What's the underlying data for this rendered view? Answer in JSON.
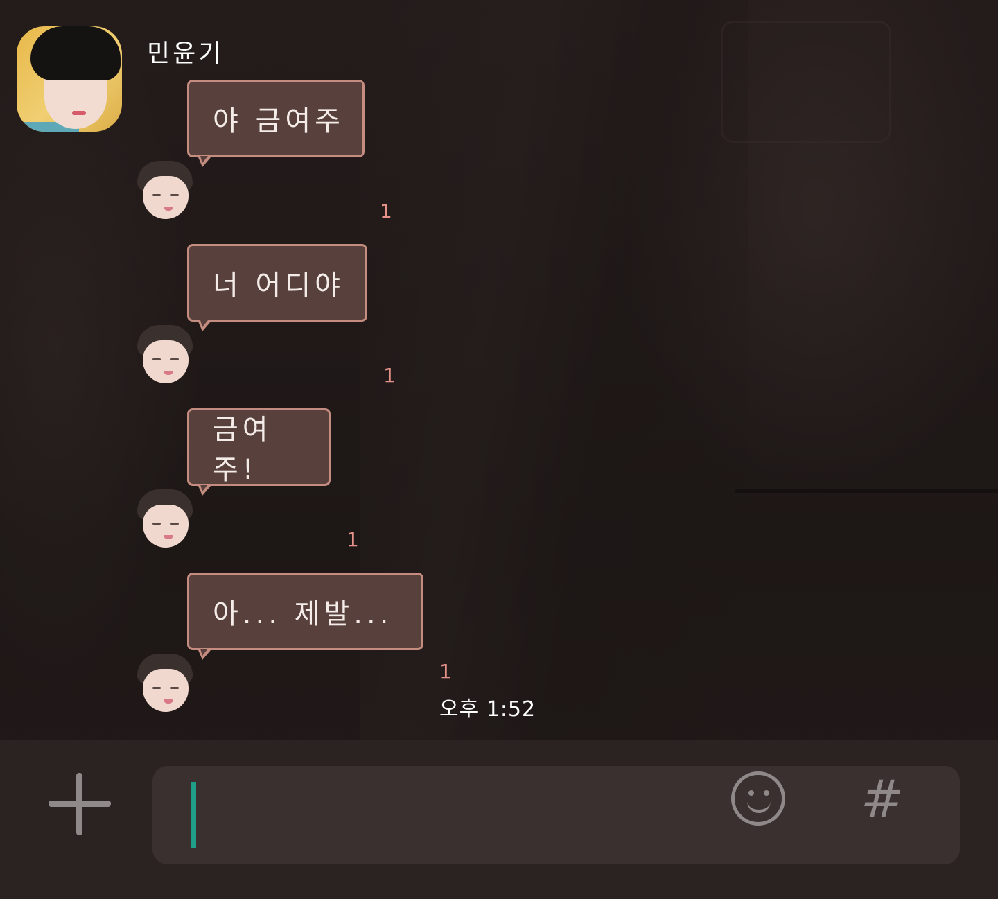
{
  "chat": {
    "sender_name": "민윤기",
    "messages": [
      {
        "text": "야 금여주",
        "unread": "1"
      },
      {
        "text": "너 어디야",
        "unread": "1"
      },
      {
        "text": "금여주!",
        "unread": "1"
      },
      {
        "text": "아... 제발...",
        "unread": "1"
      }
    ],
    "last_timestamp": "오후 1:52"
  },
  "input": {
    "value": "",
    "icons": {
      "add": "plus-icon",
      "emoji": "smiley-icon",
      "hashtag": "hash-icon"
    },
    "hash_glyph": "#"
  },
  "colors": {
    "bubble_bg": "#58403c",
    "bubble_border": "#c58c80",
    "unread": "#e6928a",
    "caret": "#1f9e89",
    "icon": "#8f8a89"
  }
}
